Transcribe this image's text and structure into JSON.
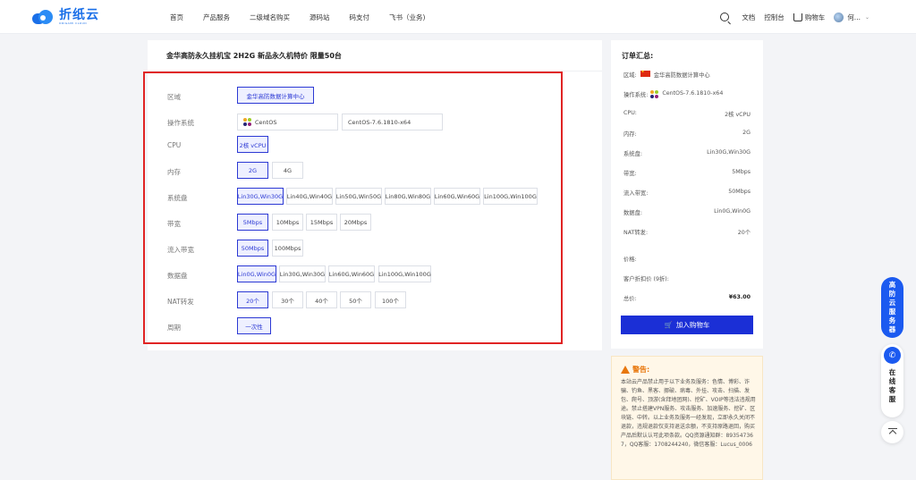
{
  "brand": {
    "name": "折纸云",
    "subtitle": "ORIGAMI CLOUD"
  },
  "nav": [
    "首页",
    "产品服务",
    "二级域名购买",
    "源码站",
    "码支付",
    "飞书（业务)"
  ],
  "header_right": {
    "docs": "文档",
    "console": "控制台",
    "cart": "购物车",
    "user": "何..."
  },
  "product": {
    "title": "金华高防永久挂机宝 2H2G 新品永久机特价 限量50台"
  },
  "config": {
    "region": {
      "label": "区域",
      "options": [
        "金华高防数据计算中心"
      ]
    },
    "os": {
      "label": "操作系统",
      "options": [
        "CentOS",
        "CentOS-7.6.1810-x64"
      ]
    },
    "cpu": {
      "label": "CPU",
      "options": [
        "2核 vCPU"
      ]
    },
    "memory": {
      "label": "内存",
      "options": [
        "2G",
        "4G"
      ]
    },
    "system_disk": {
      "label": "系统盘",
      "options": [
        "Lin30G,Win30G",
        "Lin40G,Win40G",
        "Lin50G,Win50G",
        "Lin80G,Win80G",
        "Lin60G,Win60G",
        "Lin100G,Win100G"
      ]
    },
    "bandwidth": {
      "label": "带宽",
      "options": [
        "5Mbps",
        "10Mbps",
        "15Mbps",
        "20Mbps"
      ]
    },
    "inbound": {
      "label": "流入带宽",
      "options": [
        "50Mbps",
        "100Mbps"
      ]
    },
    "data_disk": {
      "label": "数据盘",
      "options": [
        "Lin0G,Win0G",
        "Lin30G,Win30G",
        "Lin60G,Win60G",
        "Lin100G,Win100G"
      ]
    },
    "nat": {
      "label": "NAT转发",
      "options": [
        "20个",
        "30个",
        "40个",
        "50个",
        "100个"
      ]
    },
    "period": {
      "label": "周期",
      "options": [
        "一次性"
      ]
    }
  },
  "order": {
    "title": "订单汇总:",
    "region_label": "区域:",
    "region_value": "金华高防数据计算中心",
    "os_label": "操作系统:",
    "os_value": "CentOS-7.6.1810-x64",
    "rows": [
      {
        "label": "CPU:",
        "value": "2核 vCPU"
      },
      {
        "label": "内存:",
        "value": "2G"
      },
      {
        "label": "系统盘:",
        "value": "Lin30G,Win30G"
      },
      {
        "label": "带宽:",
        "value": "5Mbps"
      },
      {
        "label": "流入带宽:",
        "value": "50Mbps"
      },
      {
        "label": "数据盘:",
        "value": "Lin0G,Win0G"
      },
      {
        "label": "NAT转发:",
        "value": "20个"
      }
    ],
    "price_label": "价格:",
    "discount_label": "客户折扣价 (9折):",
    "total_label": "总价:",
    "total_value": "¥63.00",
    "add_button": "加入购物车"
  },
  "warning": {
    "title": "警告:",
    "text": "本站云产品禁止用于以下业务及服务：色情、博彩、诈骗、钓鱼、黑客、挪破、病毒、外挂、攻击、扫描、发包、爬号、顶游(含拜地团网)、挖矿、VOIP等违法违规用途。禁止搭建VPN服务、攻击服务、加速服务、挖矿、区块链、中转。以上业务及服务一经发现，立即永久关闭不退款，违规退款仅支持退送余额，不支持原路退回，购买产品后默认认可此项条款。QQ资源通知群：893547367，QQ客服：1708244240，微信客服：Lucus_0006"
  },
  "float": {
    "service_chars": [
      "高",
      "防",
      "云",
      "服",
      "务",
      "器"
    ],
    "online_chars": [
      "在",
      "线",
      "客",
      "服"
    ]
  }
}
